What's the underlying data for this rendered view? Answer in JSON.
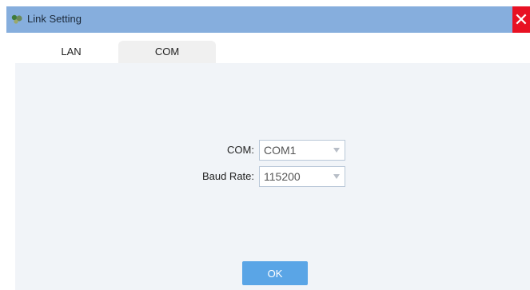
{
  "window": {
    "title": "Link Setting",
    "close_glyph": "✕",
    "icon": "app-logo-icon",
    "titlebar_color": "#86aedd",
    "close_color": "#e81123"
  },
  "tabs": [
    {
      "label": "LAN",
      "selected": false
    },
    {
      "label": "COM",
      "selected": true
    }
  ],
  "form": {
    "com_label": "COM:",
    "com_value": "COM1",
    "baud_label": "Baud Rate:",
    "baud_value": "115200"
  },
  "actions": {
    "ok_label": "OK",
    "ok_color": "#5aa5e6"
  }
}
